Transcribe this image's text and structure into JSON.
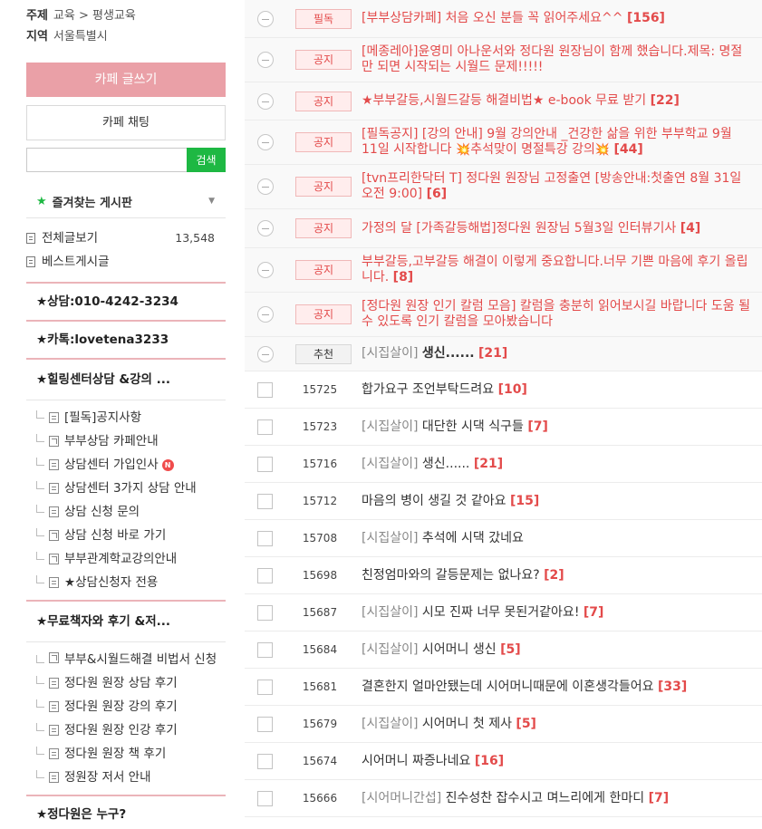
{
  "cafe_info": {
    "topic_key": "주제",
    "topic_value": "교육 > 평생교육",
    "region_key": "지역",
    "region_value": "서울특별시"
  },
  "buttons": {
    "write": "카페 글쓰기",
    "chat": "카페 채팅",
    "search": "검색"
  },
  "search": {
    "placeholder": ""
  },
  "favorites": {
    "title": "즐겨찾는 게시판"
  },
  "menu": {
    "all_posts": "전체글보기",
    "all_posts_count": "13,548",
    "best": "베스트게시글",
    "phone": "★상담:010-4242-3234",
    "kakao": "★카톡:lovetena3233",
    "healing_title": "★힐링센터상담 &강의 ...",
    "healing_items": [
      "[필독]공지사항",
      "부부상담 카페안내",
      "상담센터 가입인사",
      "상담센터 3가지 상담 안내",
      "상담 신청 문의",
      "상담 신청 바로 가기",
      "부부관계학교강의안내",
      "★상담신청자 전용"
    ],
    "new_badge": "N",
    "books_title": "★무료책자와 후기 &저...",
    "books_item_first": "부부&시월드해결 비법서 신청",
    "books_items": [
      "정다원 원장 상담 후기",
      "정다원 원장 강의 후기",
      "정다원 원장 인강 후기",
      "정다원 원장 책 후기",
      "정원장 저서 안내"
    ],
    "last_title": "★정다원은 누구?"
  },
  "notices": [
    {
      "badge": "필독",
      "title": "[부부상담카페] 처음 오신 분들 꼭 읽어주세요^^",
      "comments": "[156]"
    },
    {
      "badge": "공지",
      "title": "[메종레아]윤영미 아나운서와 정다원 원장님이 함께 했습니다.제목: 명절만 되면 시작되는 시월드 문제!!!!!",
      "comments": ""
    },
    {
      "badge": "공지",
      "title": "★부부갈등,시월드갈등 해결비법★ e-book 무료 받기",
      "comments": "[22]"
    },
    {
      "badge": "공지",
      "title_a": "[필독공지] [강의 안내] 9월 강의안내 _건강한 삶을 위한 부부학교 9월 11일 시작합니다 ",
      "bomb1": "💥",
      "title_b": "추석맞이 명절특강 강의",
      "bomb2": "💥",
      "comments": "[44]"
    },
    {
      "badge": "공지",
      "title": "[tvn프리한닥터 T] 정다원 원장님 고정출연 [방송안내:첫출연 8월 31일 오전 9:00]",
      "comments": "[6]"
    },
    {
      "badge": "공지",
      "title": "가정의 달 [가족갈등해법]정다원 원장님 5월3일 인터뷰기사",
      "comments": "[4]"
    },
    {
      "badge": "공지",
      "title": "부부갈등,고부갈등 해결이 이렇게 중요합니다.너무 기쁜 마음에 후기 올립니다.",
      "comments": "[8]"
    },
    {
      "badge": "공지",
      "title": "[정다원 원장 인기 칼럼 모음] 칼럼을 충분히 읽어보시길 바랍니다 도움 될 수 있도록 인기 칼럼을 모아봤습니다",
      "comments": ""
    }
  ],
  "recommended": {
    "badge": "추천",
    "head": "[시집살이]",
    "title": "생신......",
    "comments": "[21]"
  },
  "posts": [
    {
      "num": "15725",
      "head": "",
      "title": "합가요구 조언부탁드려요",
      "comments": "[10]"
    },
    {
      "num": "15723",
      "head": "[시집살이]",
      "title": "대단한 시댁 식구들",
      "comments": "[7]"
    },
    {
      "num": "15716",
      "head": "[시집살이]",
      "title": "생신......",
      "comments": "[21]"
    },
    {
      "num": "15712",
      "head": "",
      "title": "마음의 병이 생길 것 같아요",
      "comments": "[15]"
    },
    {
      "num": "15708",
      "head": "[시집살이]",
      "title": "추석에 시댁 갔네요",
      "comments": ""
    },
    {
      "num": "15698",
      "head": "",
      "title": "친정엄마와의 갈등문제는 없나요?",
      "comments": "[2]"
    },
    {
      "num": "15687",
      "head": "[시집살이]",
      "title": "시모 진짜 너무 못된거같아요!",
      "comments": "[7]"
    },
    {
      "num": "15684",
      "head": "[시집살이]",
      "title": "시어머니 생신",
      "comments": "[5]"
    },
    {
      "num": "15681",
      "head": "",
      "title": "결혼한지 얼마안됐는데 시어머니때문에 이혼생각들어요",
      "comments": "[33]"
    },
    {
      "num": "15679",
      "head": "[시집살이]",
      "title": "시어머니 첫 제사",
      "comments": "[5]"
    },
    {
      "num": "15674",
      "head": "",
      "title": "시어머니 짜증나네요",
      "comments": "[16]"
    },
    {
      "num": "15666",
      "head": "[시어머니간섭]",
      "title": "진수성찬 잡수시고 며느리에게 한마디",
      "comments": "[7]"
    }
  ],
  "colors": {
    "accent_pink": "#eaa0a7",
    "search_green": "#1eb843",
    "notice_red": "#e34a4a"
  }
}
